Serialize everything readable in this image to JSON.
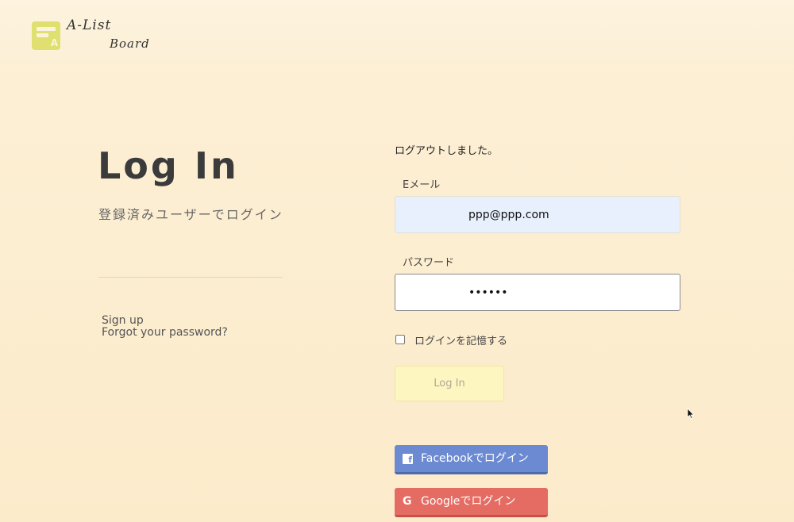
{
  "brand": {
    "line1": "A-List",
    "line2": "Board",
    "badge_letter": "A"
  },
  "page": {
    "heading": "Log In",
    "subheading": "登録済みユーザーでログイン"
  },
  "links": {
    "signup": "Sign up",
    "forgot": "Forgot your password?"
  },
  "form": {
    "flash_message": "ログアウトしました。",
    "email_label": "Eメール",
    "email_value": "ppp@ppp.com",
    "password_label": "パスワード",
    "password_value": "••••••",
    "remember_label": "ログインを記憶する",
    "remember_checked": false,
    "submit_label": "Log In"
  },
  "social": {
    "facebook_label": "Facebookでログイン",
    "google_label": "Googleでログイン",
    "facebook_icon": "f",
    "google_icon": "G"
  },
  "colors": {
    "background": "#fdf0d6",
    "facebook": "#6b8ad2",
    "google": "#e56c63",
    "submit": "#fef6c0",
    "logo": "#dfe070"
  }
}
